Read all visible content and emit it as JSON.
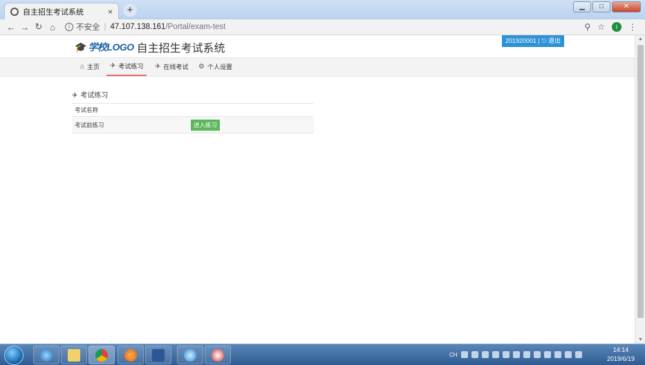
{
  "browser": {
    "tab_title": "自主招生考试系统",
    "tab_close": "×",
    "new_tab": "+",
    "insecure_label": "不安全",
    "url_host": "47.107.138.161",
    "url_path": "/Portal/exam-test",
    "profile_initial": "I"
  },
  "header": {
    "logo_text": "学校LOGO",
    "site_title": "自主招生考试系统",
    "user_id": "201920001",
    "logout_label": "退出"
  },
  "nav": {
    "items": [
      {
        "label": "主页",
        "icon": "home-icon"
      },
      {
        "label": "考试练习",
        "icon": "paper-plane-icon"
      },
      {
        "label": "在线考试",
        "icon": "paper-plane-icon"
      },
      {
        "label": "个人设置",
        "icon": "gears-icon"
      }
    ],
    "active_index": 1
  },
  "panel": {
    "title": "考试练习",
    "column_header": "考试名称",
    "rows": [
      {
        "name": "考试前练习",
        "action_label": "进入练习"
      }
    ]
  },
  "taskbar": {
    "time": "14:14",
    "date": "2019/6/19",
    "ime": "CH"
  }
}
